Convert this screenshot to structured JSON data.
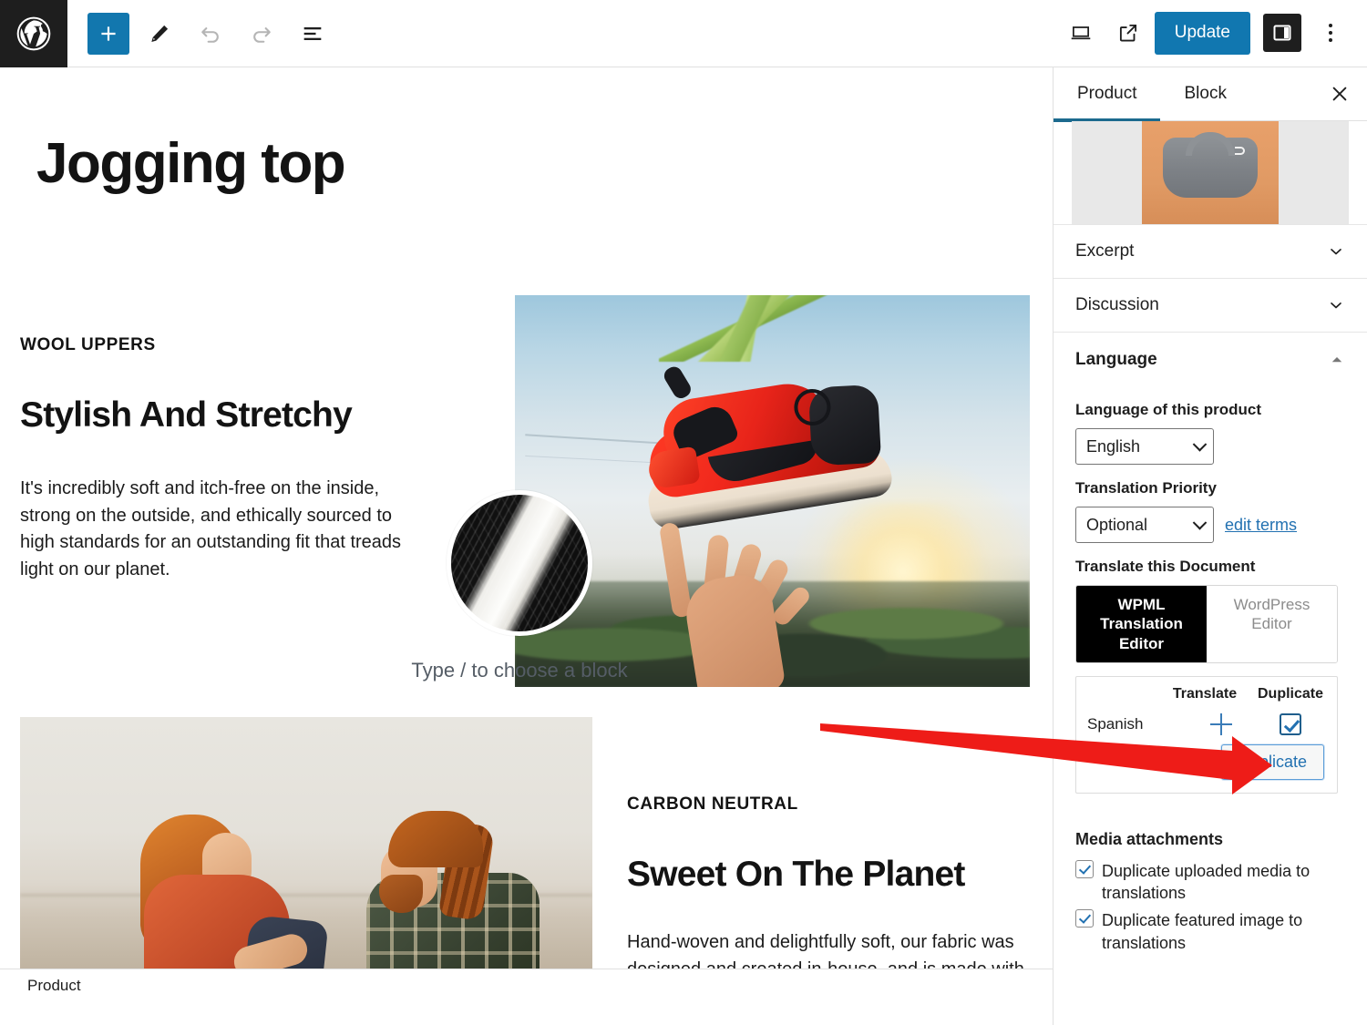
{
  "toolbar": {
    "wp_logo": "wordpress-logo",
    "add_block_label": "+",
    "icons": [
      "add-block-icon",
      "edit-tool-icon",
      "undo-icon",
      "redo-icon",
      "document-overview-icon"
    ],
    "update_label": "Update",
    "view_icon": "desktop-preview-icon",
    "external_icon": "view-post-external-icon",
    "sidebar_toggle_icon": "settings-sidebar-icon",
    "options_icon": "kebab-menu-icon"
  },
  "editor": {
    "post_title": "Jogging top",
    "section_one": {
      "eyebrow": "WOOL UPPERS",
      "heading": "Stylish And Stretchy",
      "paragraph": "It's incredibly soft and itch-free on the inside, strong on the outside, and ethically sourced to high standards for an outstanding fit that treads light on our planet."
    },
    "block_placeholder": "Type / to choose a block",
    "section_two": {
      "eyebrow": "CARBON NEUTRAL",
      "heading": "Sweet On The Planet",
      "paragraph": "Hand-woven and delightfully soft, our fabric was designed and created in-house, and is made with the world's first carbon neutral green EVA"
    },
    "status_bar": "Product"
  },
  "sidebar": {
    "tabs": [
      {
        "label": "Product",
        "active": true
      },
      {
        "label": "Block",
        "active": false
      }
    ],
    "close_icon": "close-icon",
    "featured_image_alt": "featured-image-sports-bra",
    "panels": [
      {
        "label": "Excerpt",
        "state": "collapsed"
      },
      {
        "label": "Discussion",
        "state": "collapsed"
      },
      {
        "label": "Language",
        "state": "expanded"
      }
    ],
    "language": {
      "language_of_product_label": "Language of this product",
      "language_value": "English",
      "translation_priority_label": "Translation Priority",
      "priority_value": "Optional",
      "edit_terms_link": "edit terms",
      "translate_document_label": "Translate this Document",
      "editor_toggle": [
        {
          "label": "WPML Translation Editor",
          "active": true
        },
        {
          "label": "WordPress Editor",
          "active": false
        }
      ],
      "table": {
        "headers": [
          "Translate",
          "Duplicate"
        ],
        "rows": [
          {
            "language": "Spanish",
            "translate": "+",
            "duplicate_checked": true
          }
        ],
        "duplicate_button": "Duplicate"
      }
    },
    "media_attachments": {
      "title": "Media attachments",
      "options": [
        {
          "label": "Duplicate uploaded media to translations",
          "checked": true
        },
        {
          "label": "Duplicate featured image to translations",
          "checked": true
        }
      ]
    }
  },
  "annotation": {
    "type": "red-arrow",
    "color": "#ee1c18",
    "points_to": "Duplicate"
  },
  "colors": {
    "accent_blue": "#1177b0",
    "link_blue": "#2271b1",
    "tab_underline": "#1c6a8e",
    "dark": "#1e1e1e",
    "annotation_red": "#ee1c18"
  }
}
